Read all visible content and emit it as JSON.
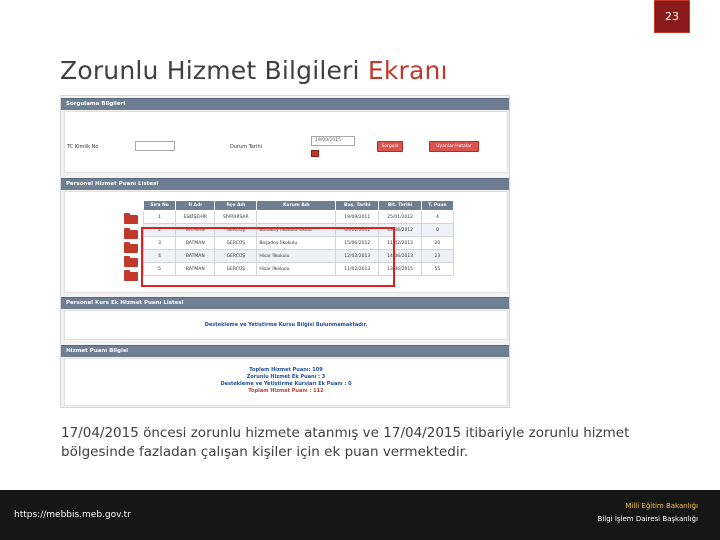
{
  "slide": {
    "page_number": "23",
    "title_plain": "Zorunlu Hizmet Bilgileri ",
    "title_highlight": "Ekranı",
    "description": "17/04/2015 öncesi zorunlu hizmete atanmış ve 17/04/2015  itibariyle zorunlu hizmet bölgesinde fazladan çalışan kişiler için ek puan vermektedir.",
    "accent_color": "#c0392b"
  },
  "screen": {
    "query_section": {
      "title": "Sorgulama Bilgileri",
      "tc_label": "TC Kimlik No",
      "tc_value": "",
      "date_label": "Durum Tarihi",
      "date_value": "19/09/2015",
      "query_button": "Sorgula",
      "warnings_button": "Uyarılar-Hatalar"
    },
    "points_section": {
      "title": "Personel Hizmet Puanı Listesi",
      "columns": [
        "Sıra No",
        "İl Adı",
        "İlçe Adı",
        "Kurum Adı",
        "Baş. Tarihi",
        "Bit. Tarihi",
        "T. Puan"
      ],
      "rows": [
        [
          "1",
          "ESKİŞEHİR",
          "SİVRİHİSAR",
          "",
          "19/09/2011",
          "25/01/2012",
          "4"
        ],
        [
          "2",
          "BATMAN",
          "GERCÜŞ",
          "Budakoy İlkokulu Okulu",
          "06/02/2012",
          "13/06/2012",
          "0"
        ],
        [
          "3",
          "BATMAN",
          "GERCÜŞ",
          "Beşadey İlkokulu",
          "15/06/2012",
          "11/02/2013",
          "20"
        ],
        [
          "4",
          "BATMAN",
          "GERCÜŞ",
          "Hisar İlkokulu",
          "12/02/2013",
          "14/06/2013",
          "23"
        ],
        [
          "5",
          "BATMAN",
          "GERCÜŞ",
          "Hisar İlkokulu",
          "11/02/2013",
          "13/06/2015",
          "55"
        ]
      ]
    },
    "course_section": {
      "title": "Personel Kurs Ek Hizmet Puanı Listesi",
      "message": "Destekleme ve Yetiştirme Kursu Bilgisi Bulunmamaktadır."
    },
    "summary_section": {
      "title": "Hizmet Puanı Bilgisi",
      "lines": [
        "Toplam Hizmet Puanı: 109",
        "Zorunlu Hizmet Ek Puanı : 3",
        "Destekleme ve Yetiştirme Kursları Ek Puanı : 0",
        "Toplam Hizmet Puanı : 112"
      ]
    }
  },
  "footer": {
    "url": "https://mebbis.meb.gov.tr",
    "org_line1": "Milli Eğitim Bakanlığı",
    "org_line2": "Bilgi İşlem Dairesi Başkanlığı"
  }
}
